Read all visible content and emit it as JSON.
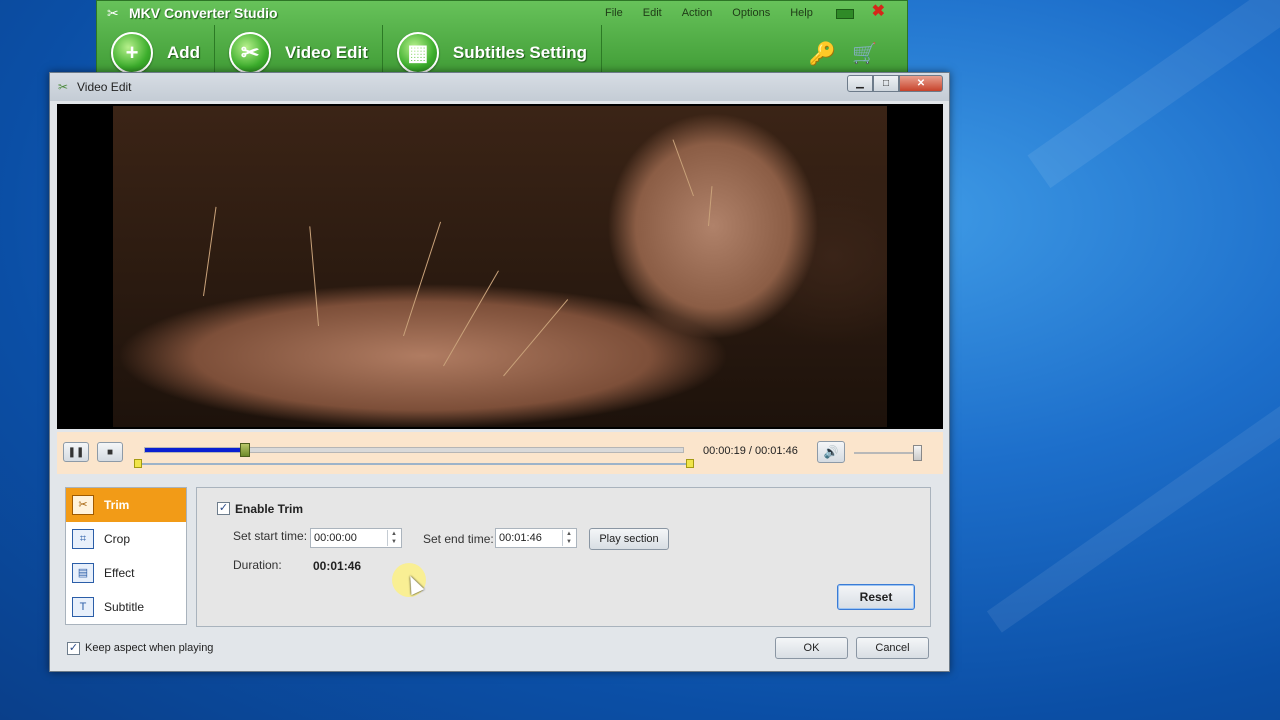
{
  "app": {
    "title": "MKV Converter Studio",
    "menu": [
      "File",
      "Edit",
      "Action",
      "Options",
      "Help"
    ],
    "toolbar": {
      "add_label": "Add",
      "video_edit_label": "Video Edit",
      "subtitles_label": "Subtitles Setting"
    },
    "colors": {
      "header_green": "#4caf3f",
      "accent_orange": "#f29b17",
      "seek_blue": "#0a1fd1"
    }
  },
  "dialog": {
    "title": "Video Edit",
    "player": {
      "current_time": "00:00:19",
      "total_time": "00:01:46",
      "time_display": "00:00:19 / 00:01:46",
      "progress_fraction": 0.185,
      "trim_start_fraction": 0.0,
      "trim_end_fraction": 1.0,
      "volume_fraction": 0.95
    },
    "nav": [
      {
        "label": "Trim",
        "icon": "trim-icon",
        "active": true
      },
      {
        "label": "Crop",
        "icon": "crop-icon",
        "active": false
      },
      {
        "label": "Effect",
        "icon": "effect-icon",
        "active": false
      },
      {
        "label": "Subtitle",
        "icon": "subtitle-icon",
        "active": false
      }
    ],
    "trim": {
      "enable_label": "Enable Trim",
      "enabled": true,
      "start_label": "Set start time:",
      "start_value": "00:00:00",
      "end_label": "Set end time:",
      "end_value": "00:01:46",
      "play_section_label": "Play section",
      "duration_label": "Duration:",
      "duration_value": "00:01:46",
      "reset_label": "Reset"
    },
    "keep_aspect_label": "Keep aspect when playing",
    "keep_aspect_checked": true,
    "ok_label": "OK",
    "cancel_label": "Cancel"
  }
}
